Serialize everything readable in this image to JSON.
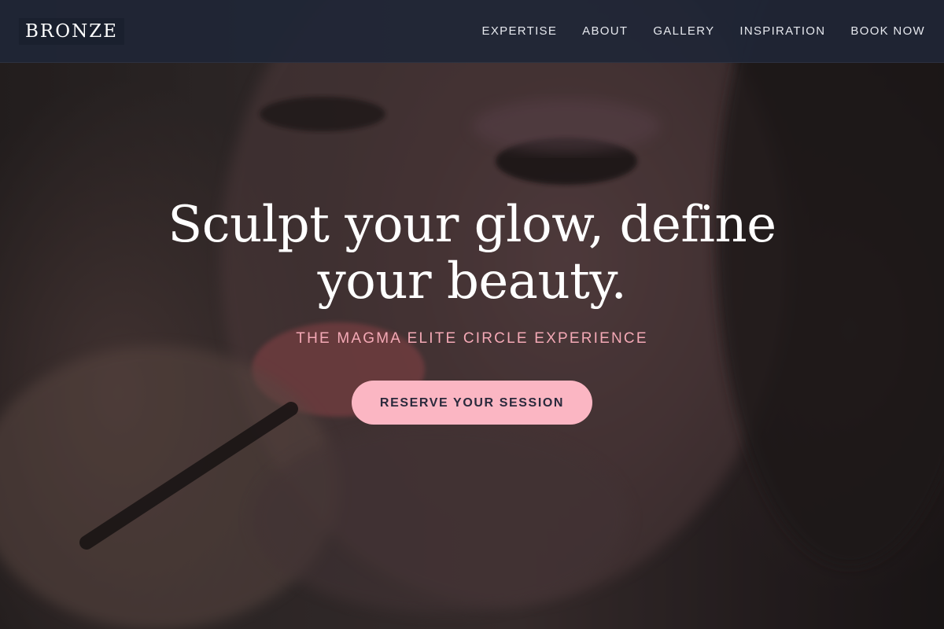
{
  "brand": {
    "logo_text": "BRONZE"
  },
  "nav": {
    "items": [
      {
        "label": "EXPERTISE"
      },
      {
        "label": "ABOUT"
      },
      {
        "label": "GALLERY"
      },
      {
        "label": "INSPIRATION"
      },
      {
        "label": "BOOK NOW"
      }
    ]
  },
  "hero": {
    "headline": "Sculpt your glow, define your beauty.",
    "subtitle": "THE MAGMA ELITE CIRCLE EXPERIENCE",
    "cta_label": "RESERVE YOUR SESSION",
    "background_image": "makeup-artist-applying-lip-liner-photo"
  },
  "colors": {
    "nav_background": "#1f2636",
    "accent_pink": "#fbb6c3",
    "subtitle_pink": "#f4a9b6",
    "cta_text": "#2a2a3c",
    "headline_text": "#ffffff"
  }
}
